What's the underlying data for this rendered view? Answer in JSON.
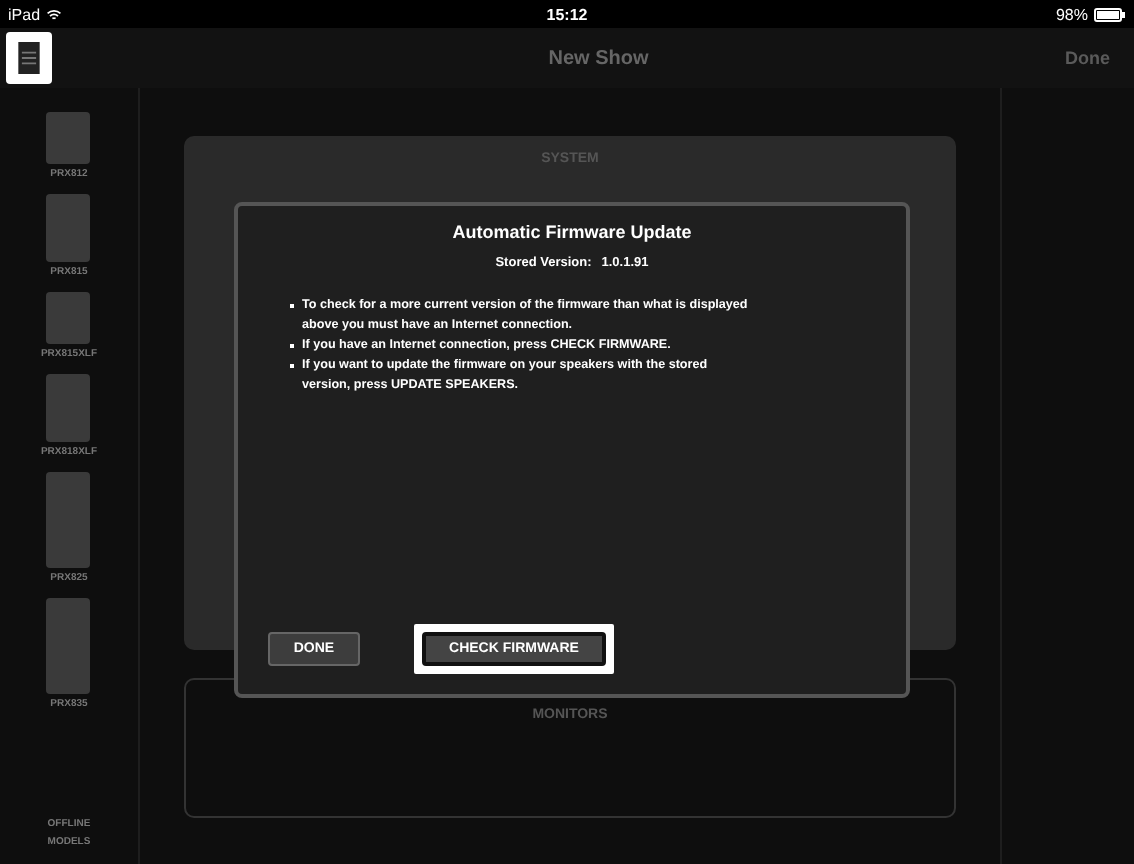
{
  "status_bar": {
    "device": "iPad",
    "time": "15:12",
    "battery": "98%"
  },
  "nav": {
    "title": "New Show",
    "done": "Done"
  },
  "sidebar": {
    "models": [
      {
        "name": "PRX812",
        "kind": "short"
      },
      {
        "name": "PRX815",
        "kind": "medium"
      },
      {
        "name": "PRX815XLF",
        "kind": "short"
      },
      {
        "name": "PRX818XLF",
        "kind": "medium"
      },
      {
        "name": "PRX825",
        "kind": "tall"
      },
      {
        "name": "PRX835",
        "kind": "tall"
      }
    ],
    "footer": "OFFLINE MODELS"
  },
  "panels": [
    {
      "title": "SYSTEM"
    },
    {
      "title": "MONITORS"
    }
  ],
  "dialog": {
    "title": "Automatic Firmware Update",
    "version_label": "Stored Version:",
    "version": "1.0.1.91",
    "bullets": [
      "To check for a more current version of the firmware than what is displayed above you must have an Internet connection.",
      "If you have an Internet connection, press CHECK FIRMWARE.",
      "If you want to update the firmware on your speakers with the stored version, press UPDATE SPEAKERS."
    ],
    "buttons": [
      {
        "label": "DONE",
        "highlighted": false
      },
      {
        "label": "CHECK FIRMWARE",
        "highlighted": true
      }
    ]
  }
}
